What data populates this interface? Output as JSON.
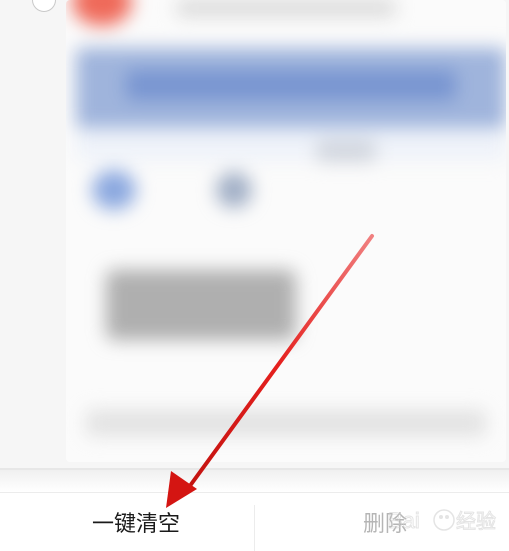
{
  "action_bar": {
    "clear_all_label": "一键清空",
    "delete_label": "删除"
  },
  "colors": {
    "arrow": "#e5201e",
    "delete_disabled": "#b5b5b5",
    "clear_text": "#1a1a1a"
  },
  "watermark": {
    "text": "Bai经验"
  }
}
